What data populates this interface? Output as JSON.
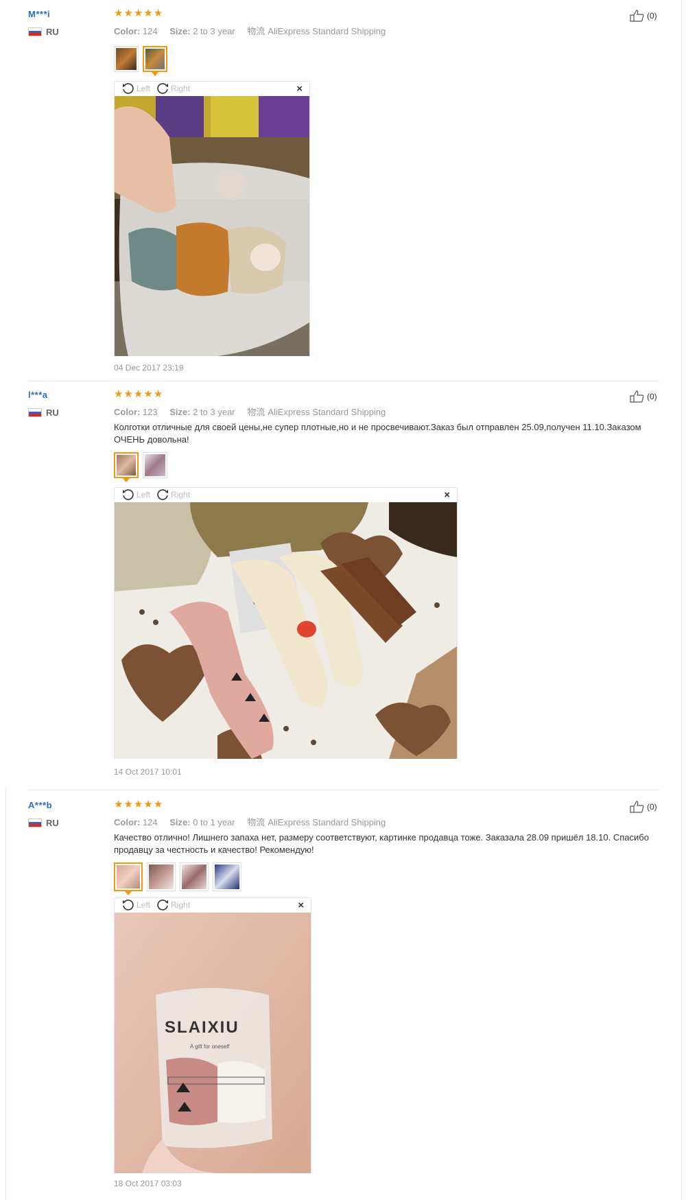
{
  "labels": {
    "color": "Color:",
    "size": "Size:",
    "shipping_icon_text": "物流",
    "rotate_left": "Left",
    "rotate_right": "Right",
    "close": "×"
  },
  "reviews": [
    {
      "user": "M***i",
      "country": "RU",
      "stars": 5,
      "color": "124",
      "size": "2 to 3 year",
      "shipping": "AliExpress Standard Shipping",
      "likes": "(0)",
      "text": "",
      "date": "04 Dec 2017 23:19"
    },
    {
      "user": "l***a",
      "country": "RU",
      "stars": 5,
      "color": "123",
      "size": "2 to 3 year",
      "shipping": "AliExpress Standard Shipping",
      "likes": "(0)",
      "text": "Колготки отличные для своей цены,не супер плотные,но и не просвечивают.Заказ был отправлен 25.09,получен 11.10.Заказом ОЧЕНЬ довольна!",
      "date": "14 Oct 2017 10:01"
    },
    {
      "user": "A***b",
      "country": "RU",
      "stars": 5,
      "color": "124",
      "size": "0 to 1 year",
      "shipping": "AliExpress Standard Shipping",
      "likes": "(0)",
      "text": "Качество отлично! Лишнего запаха нет, размеру соответствуют, картинке продавца тоже. Заказала 28.09 пришёл 18.10. Спасибо продавцу за честность и качество! Рекомендую!",
      "date": "18 Oct 2017 03:03"
    }
  ],
  "photo_texts": {
    "bag_brand": "SLAIXIU",
    "bag_tagline": "A gift for oneself"
  },
  "colors": {
    "username": "#2a6cc1",
    "star": "#f39813",
    "active_thumb": "#f39813",
    "muted": "#999999"
  }
}
